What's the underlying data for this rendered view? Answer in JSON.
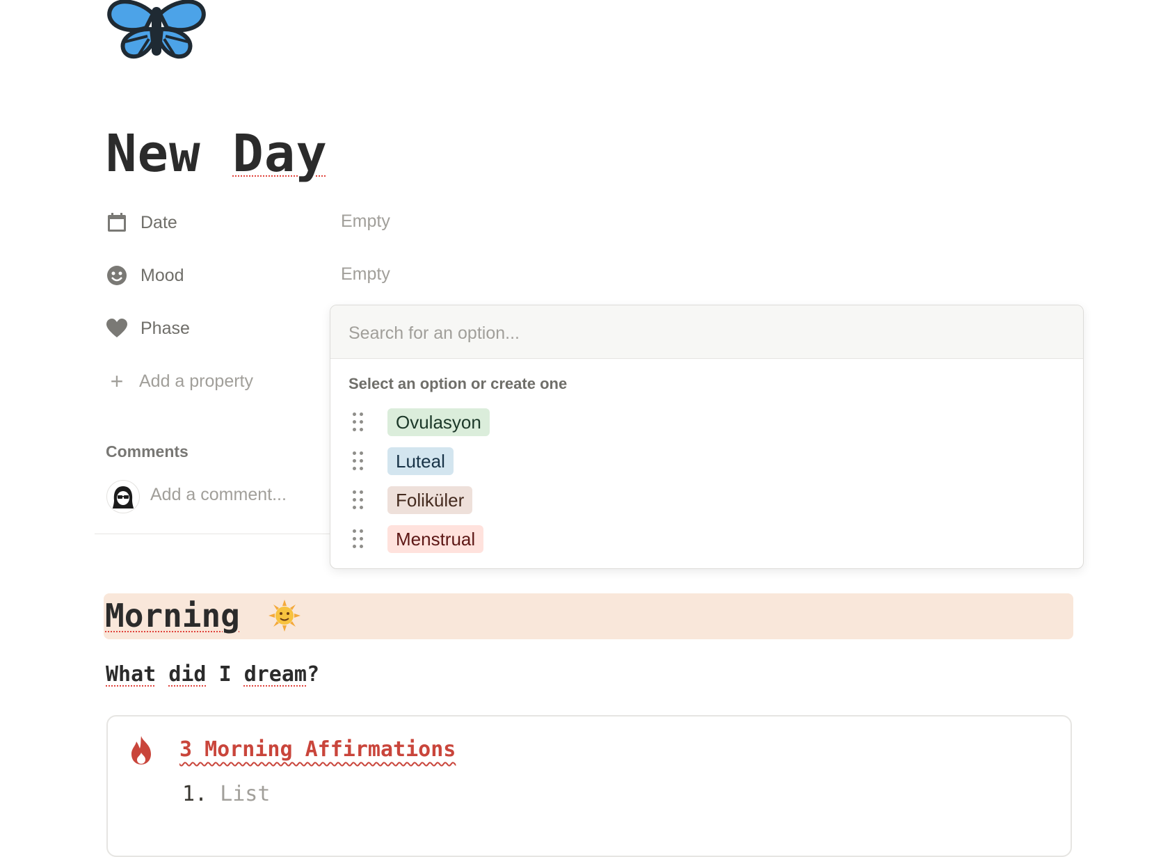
{
  "page": {
    "title_word1": "New",
    "title_word2": "Day",
    "icon": "butterfly-icon"
  },
  "properties": [
    {
      "icon": "calendar-icon",
      "label": "Date",
      "value": "Empty"
    },
    {
      "icon": "smiley-icon",
      "label": "Mood",
      "value": "Empty"
    },
    {
      "icon": "heart-icon",
      "label": "Phase",
      "value": ""
    }
  ],
  "add_property": {
    "label": "Add a property"
  },
  "comments": {
    "heading": "Comments",
    "placeholder": "Add a comment..."
  },
  "dropdown": {
    "search_placeholder": "Search for an option...",
    "hint": "Select an option or create one",
    "options": [
      {
        "label": "Ovulasyon",
        "bg": "#dbeddb",
        "fg": "#1c3829"
      },
      {
        "label": "Luteal",
        "bg": "#d3e5ef",
        "fg": "#183347"
      },
      {
        "label": "Foliküler",
        "bg": "#eee0da",
        "fg": "#442a1e"
      },
      {
        "label": "Menstrual",
        "bg": "#ffe2dd",
        "fg": "#5d1715"
      }
    ]
  },
  "morning": {
    "heading": "Morning",
    "emoji": "sun-with-face-icon",
    "banner_color": "#f9e7da"
  },
  "dream": {
    "w1": "What",
    "w2": "did",
    "w3": "I",
    "w4": "dream",
    "end": "?"
  },
  "callout": {
    "icon": "fire-icon",
    "link": "3 Morning Affirmations",
    "list_number": "1.",
    "list_placeholder": "List"
  }
}
